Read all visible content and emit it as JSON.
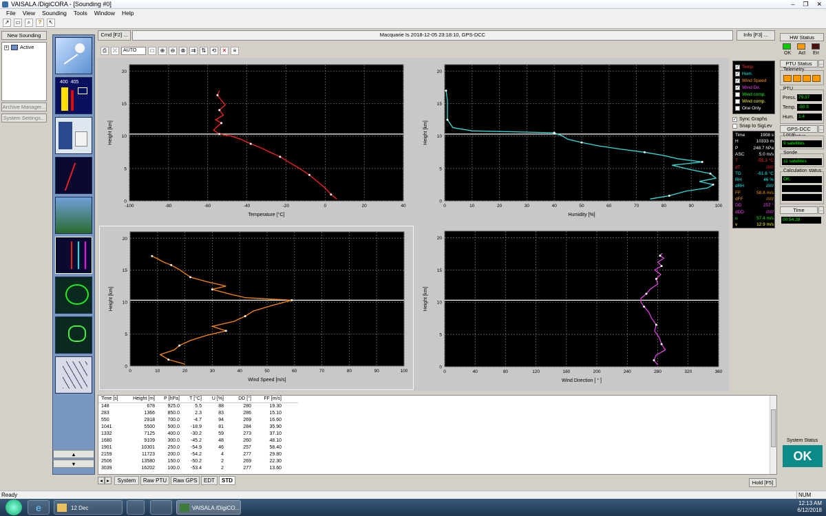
{
  "window": {
    "title": "VAISALA /DigiCORA - [Sounding #0]",
    "buttons": [
      "–",
      "❐",
      "✕"
    ]
  },
  "menu": [
    "File",
    "View",
    "Sounding",
    "Tools",
    "Window",
    "Help"
  ],
  "left": {
    "new_sounding": "New Sounding",
    "tree_active": "Active",
    "archive_manager": "Archive Manager...",
    "system_settings": "System Settings...",
    "iconbar_up": "▲",
    "iconbar_down": "▼"
  },
  "cmdbar": {
    "cmd": "Cmd [F2] ...",
    "location": "Macquarie Is 2018-12-05 23:18:10, GPS-DCC",
    "info": "Info [F3] ..."
  },
  "plot_toolbar": {
    "mode": "AUTO"
  },
  "legend": {
    "items": [
      {
        "label": "Temp.",
        "color": "#ff3030",
        "checked": true
      },
      {
        "label": "Hum.",
        "color": "#00ffff",
        "checked": true
      },
      {
        "label": "Wind Speed",
        "color": "#ff9900",
        "checked": true
      },
      {
        "label": "Wind Dir.",
        "color": "#ff40ff",
        "checked": true
      },
      {
        "label": "Wind comp.",
        "color": "#00ff00",
        "checked": false
      },
      {
        "label": "Wind comp.",
        "color": "#ffff00",
        "checked": false
      },
      {
        "label": "One Only",
        "color": "#ffffff",
        "checked": false
      }
    ],
    "sync_graphs": "Sync Graphs",
    "snap_to_siglev": "Snap to SigLev"
  },
  "readout": [
    {
      "k": "Time",
      "v": "1908 s",
      "kc": "#ffffff",
      "vc": "#ffffff"
    },
    {
      "k": "H",
      "v": "10333 m",
      "kc": "#ffffff",
      "vc": "#ffffff"
    },
    {
      "k": "P",
      "v": "248.7 hPa",
      "kc": "#ffffff",
      "vc": "#ffffff"
    },
    {
      "k": "ASC",
      "v": "5.0 m/s",
      "kc": "#ffffff",
      "vc": "#ffffff"
    },
    {
      "k": "T",
      "v": "-55.3 °C",
      "kc": "#ff3030",
      "vc": "#ff3030"
    },
    {
      "k": "dT",
      "v": "//////",
      "kc": "#ff3030",
      "vc": "#ff3030"
    },
    {
      "k": "TD",
      "v": "-61.6 °C",
      "kc": "#00ffff",
      "vc": "#00ffff"
    },
    {
      "k": "RH",
      "v": "46 %",
      "kc": "#00ffff",
      "vc": "#00ffff"
    },
    {
      "k": "dRH",
      "v": "//////",
      "kc": "#00ffff",
      "vc": "#00ffff"
    },
    {
      "k": "FF",
      "v": "58.8 m/s",
      "kc": "#ff9900",
      "vc": "#ff9900"
    },
    {
      "k": "dFF",
      "v": "//////",
      "kc": "#ff9900",
      "vc": "#ff9900"
    },
    {
      "k": "DD",
      "v": "257 °",
      "kc": "#ff40ff",
      "vc": "#ff40ff"
    },
    {
      "k": "dDD",
      "v": "//////",
      "kc": "#ff40ff",
      "vc": "#ff40ff"
    },
    {
      "k": "u",
      "v": "57.4 m/s",
      "kc": "#00ff00",
      "vc": "#00ff00"
    },
    {
      "k": "v",
      "v": "12.9 m/s",
      "kc": "#ffff00",
      "vc": "#ffff00"
    }
  ],
  "right": {
    "hw_status": "HW Status",
    "hw_labels": [
      "OK",
      "Act",
      "Err"
    ],
    "hw_colors": [
      "#00cc00",
      "#ff9900",
      "#4a1010"
    ],
    "ptu_status": "PTU Status",
    "telemetry": "Telemetry",
    "ptu": "PTU",
    "press_label": "Press.",
    "press_value": "79.37",
    "temp_label": "Temp.",
    "temp_value": "-50.9",
    "hum_label": "Hum.",
    "hum_value": "1.4",
    "gps_status": "GPS-DCC status",
    "local": "Local",
    "local_value": "9 satellites",
    "sonde": "Sonde",
    "sonde_value": "11 satellites",
    "calc_status": "Calculation status",
    "calc_value": "OK.",
    "time": "Time",
    "time_value": "00:54:28",
    "system_status": "System Status",
    "ok_button": "OK"
  },
  "chart_data": [
    {
      "type": "line",
      "xlabel": "Temperature [°C]",
      "ylabel": "Height [km]",
      "xlim": [
        -100,
        40
      ],
      "ylim": [
        0,
        21
      ],
      "xticks": [
        -100,
        -80,
        -60,
        -40,
        -20,
        0,
        20,
        40
      ],
      "yticks": [
        0,
        5,
        10,
        15,
        20
      ],
      "color": "#ff2020",
      "x": [
        6,
        3,
        0,
        -4,
        -8,
        -13,
        -18,
        -23,
        -28,
        -33,
        -38,
        -43,
        -48,
        -54,
        -57,
        -55,
        -53,
        -56,
        -52,
        -54,
        -51,
        -53,
        -55,
        -54
      ],
      "y": [
        0.3,
        1.0,
        2.0,
        3.0,
        4.0,
        5.0,
        5.9,
        6.8,
        7.5,
        8.2,
        8.8,
        9.5,
        10.0,
        10.3,
        10.9,
        11.5,
        12.0,
        12.5,
        13.2,
        14.0,
        14.8,
        15.5,
        16.3,
        17.0
      ]
    },
    {
      "type": "line",
      "xlabel": "Humidity [%]",
      "ylabel": "Height [km]",
      "xlim": [
        0,
        100
      ],
      "ylim": [
        0,
        21
      ],
      "xticks": [
        0,
        10,
        20,
        30,
        40,
        50,
        60,
        70,
        80,
        90,
        100
      ],
      "yticks": [
        0,
        5,
        10,
        15,
        20
      ],
      "color": "#30e0e0",
      "x": [
        75,
        82,
        88,
        96,
        98,
        93,
        99,
        97,
        90,
        83,
        94,
        85,
        80,
        73,
        64,
        56,
        50,
        45,
        43,
        40,
        10,
        3,
        1,
        1,
        1,
        0.5
      ],
      "y": [
        0.3,
        0.8,
        1.5,
        2.0,
        2.5,
        3.0,
        3.5,
        4.2,
        4.8,
        5.5,
        6.0,
        6.5,
        7.0,
        7.5,
        8.0,
        8.5,
        9.0,
        9.5,
        10.0,
        10.5,
        10.8,
        11.3,
        12.5,
        14.0,
        15.5,
        17.0
      ]
    },
    {
      "type": "line",
      "xlabel": "Wind Speed [m/s]",
      "ylabel": "Height [km]",
      "xlim": [
        0,
        100
      ],
      "ylim": [
        0,
        21
      ],
      "xticks": [
        0,
        10,
        20,
        30,
        40,
        50,
        60,
        70,
        80,
        90,
        100
      ],
      "yticks": [
        0,
        5,
        10,
        15,
        20
      ],
      "color": "#ff8800",
      "x": [
        20,
        14,
        11,
        16,
        18,
        22,
        28,
        35,
        30,
        38,
        42,
        45,
        52,
        59,
        42,
        37,
        30,
        35,
        28,
        22,
        20,
        18,
        15,
        12,
        10,
        8
      ],
      "y": [
        0.3,
        1.0,
        1.8,
        2.5,
        3.2,
        4.0,
        4.8,
        5.5,
        6.2,
        7.0,
        7.8,
        8.6,
        9.5,
        10.3,
        10.7,
        11.2,
        12.0,
        12.5,
        13.2,
        13.9,
        14.5,
        15.1,
        15.8,
        16.3,
        16.8,
        17.2
      ]
    },
    {
      "type": "line",
      "xlabel": "Wind Direction [ ° ]",
      "ylabel": "Height [km]",
      "xlim": [
        0,
        360
      ],
      "ylim": [
        0,
        21
      ],
      "xticks": [
        0,
        40,
        80,
        120,
        160,
        200,
        240,
        280,
        320,
        360
      ],
      "yticks": [
        0,
        5,
        10,
        15,
        20
      ],
      "color": "#e040e0",
      "x": [
        280,
        275,
        278,
        290,
        285,
        282,
        276,
        278,
        272,
        268,
        262,
        258,
        258,
        265,
        270,
        280,
        278,
        284,
        276,
        285,
        280,
        288,
        283,
        286
      ],
      "y": [
        0.3,
        1.0,
        1.8,
        2.6,
        3.5,
        4.5,
        5.5,
        6.5,
        7.5,
        8.5,
        9.3,
        10.0,
        10.6,
        11.3,
        12.0,
        12.8,
        13.6,
        14.3,
        15.0,
        15.6,
        16.2,
        16.8,
        17.2,
        17.6
      ]
    }
  ],
  "table": {
    "headers": [
      "Time [s]",
      "Height [m]",
      "P [hPa]",
      "T [°C]",
      "U [%]",
      "DD [°]",
      "FF [m/s]"
    ],
    "rows": [
      [
        "148",
        "678",
        "925.0",
        "5.5",
        "88",
        "280",
        "19.30"
      ],
      [
        "283",
        "1366",
        "850.0",
        "2.3",
        "83",
        "286",
        "15.10"
      ],
      [
        "550",
        "2918",
        "700.0",
        "-4.7",
        "94",
        "269",
        "16.60"
      ],
      [
        "1041",
        "5500",
        "500.0",
        "-18.9",
        "81",
        "284",
        "35.90"
      ],
      [
        "1332",
        "7125",
        "400.0",
        "-30.2",
        "59",
        "273",
        "37.10"
      ],
      [
        "1680",
        "9109",
        "300.0",
        "-45.2",
        "48",
        "260",
        "48.10"
      ],
      [
        "1901",
        "10301",
        "250.0",
        "-54.9",
        "46",
        "257",
        "58.40"
      ],
      [
        "2159",
        "11723",
        "200.0",
        "-54.2",
        "4",
        "277",
        "29.80"
      ],
      [
        "2506",
        "13580",
        "150.0",
        "-50.2",
        "2",
        "269",
        "22.30"
      ],
      [
        "3039",
        "16202",
        "100.0",
        "-53.4",
        "2",
        "277",
        "13.60"
      ]
    ]
  },
  "tabs": [
    "System",
    "Raw PTU",
    "Raw GPS",
    "EDT",
    "STD"
  ],
  "hold": "Hold [F5]",
  "status": {
    "text": "Ready",
    "num": "NUM"
  },
  "taskbar": {
    "folder": "12 Dec",
    "app": "VAISALA /DigiCO...",
    "time": "12:13 AM",
    "date": "6/12/2018"
  }
}
